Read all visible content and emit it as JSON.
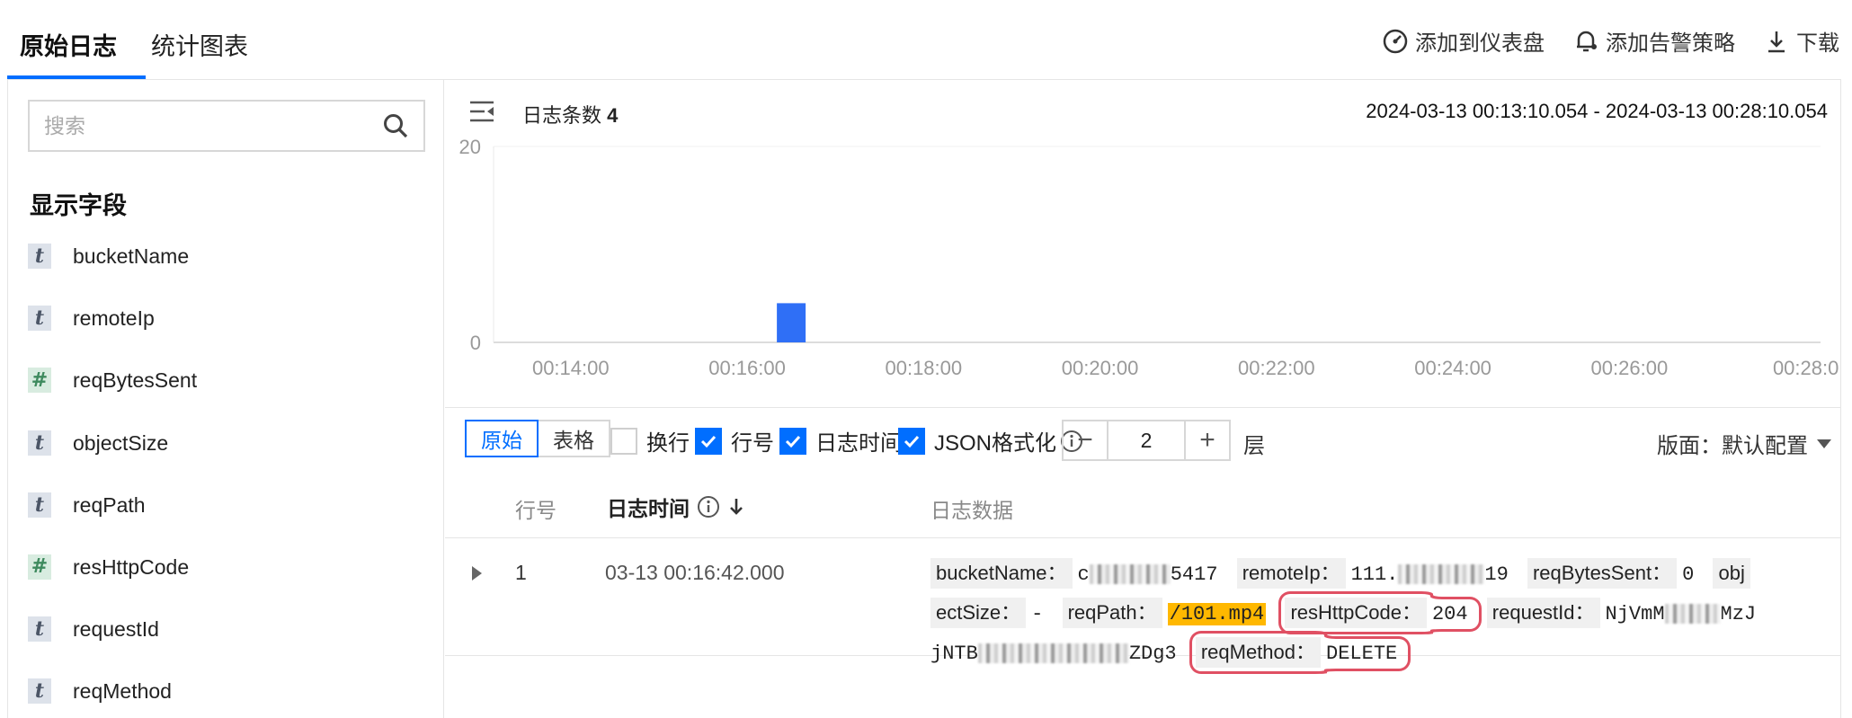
{
  "tabs": [
    {
      "label": "原始日志",
      "active": true
    },
    {
      "label": "统计图表",
      "active": false
    }
  ],
  "actions": {
    "add_dashboard": "添加到仪表盘",
    "add_alarm": "添加告警策略",
    "download": "下载"
  },
  "sidebar": {
    "search_placeholder": "搜索",
    "section_title": "显示字段",
    "fields": [
      {
        "type": "t",
        "name": "bucketName"
      },
      {
        "type": "#",
        "name": "remoteIp"
      },
      {
        "type": "#",
        "name": "reqBytesSent"
      },
      {
        "type": "t",
        "name": "objectSize"
      },
      {
        "type": "t",
        "name": "reqPath"
      },
      {
        "type": "#",
        "name": "resHttpCode"
      },
      {
        "type": "t",
        "name": "requestId"
      },
      {
        "type": "t",
        "name": "reqMethod"
      }
    ]
  },
  "summary": {
    "count_label": "日志条数",
    "count_value": "4",
    "time_range": "2024-03-13 00:13:10.054 - 2024-03-13 00:28:10.054"
  },
  "chart_data": {
    "type": "bar",
    "x": [
      "00:16:30"
    ],
    "values": [
      4
    ],
    "ylim": [
      0,
      20
    ],
    "yticks": [
      "0",
      "20"
    ],
    "xticks": [
      "00:14:00",
      "00:16:00",
      "00:18:00",
      "00:20:00",
      "00:22:00",
      "00:24:00",
      "00:26:00",
      "00:28:0"
    ],
    "color": "#2f6ff6"
  },
  "toolbar": {
    "view_raw": "原始",
    "view_table": "表格",
    "wrap": "换行",
    "line_no": "行号",
    "log_time": "日志时间",
    "json_format": "JSON格式化",
    "depth_value": "2",
    "depth_unit": "层",
    "layout": "版面：默认配置",
    "minus": "−",
    "plus": "+"
  },
  "table": {
    "col_no": "行号",
    "col_time": "日志时间",
    "col_data": "日志数据",
    "rows": [
      {
        "no": "1",
        "time": "03-13 00:16:42.000",
        "pairs": {
          "bucketName_k": "bucketName：",
          "bucketName_v1": "c",
          "bucketName_v2": "5417",
          "remoteIp_k": "remoteIp：",
          "remoteIp_v1": "111.",
          "remoteIp_v2": "19",
          "reqBytesSent_k": "reqBytesSent：",
          "reqBytesSent_v": "0",
          "objectSize_k1": "obj",
          "objectSize_k2": "ectSize：",
          "objectSize_v": "-",
          "reqPath_k": "reqPath：",
          "reqPath_v": "/101.mp4",
          "resHttpCode_k": "resHttpCode：",
          "resHttpCode_v": "204",
          "requestId_k": "requestId：",
          "requestId_v1": "NjVmM",
          "requestId_v2": "MzJ",
          "requestId_v3": "jNTB",
          "requestId_v4": "ZDg3",
          "reqMethod_k": "reqMethod：",
          "reqMethod_v": "DELETE"
        }
      }
    ]
  }
}
